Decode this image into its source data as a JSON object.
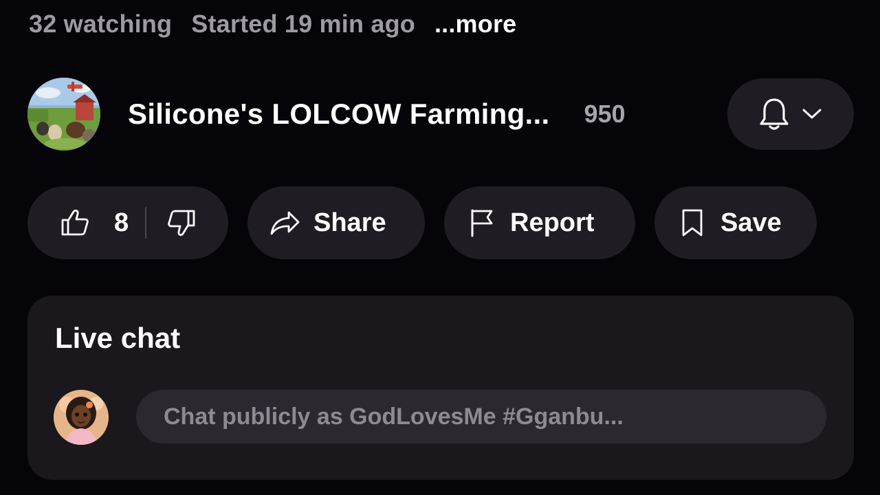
{
  "meta": {
    "watching": "32 watching",
    "started": "Started 19 min ago",
    "more": "...more"
  },
  "channel": {
    "name": "Silicone's LOLCOW Farming...",
    "subscribers": "950",
    "avatar_icon": "farm-scene-avatar",
    "bell_icon": "bell-icon",
    "dropdown_icon": "chevron-down-icon"
  },
  "actions": {
    "like_count": "8",
    "share_label": "Share",
    "report_label": "Report",
    "save_label": "Save"
  },
  "live_chat": {
    "title": "Live chat",
    "input_placeholder": "Chat publicly as GodLovesMe  #Gganbu...",
    "user_avatar_icon": "user-avatar"
  },
  "colors": {
    "background": "#050408",
    "pill": "#1f1d23",
    "card": "#1a181d",
    "input": "#2b292f",
    "muted_text": "#9d9aa2"
  }
}
